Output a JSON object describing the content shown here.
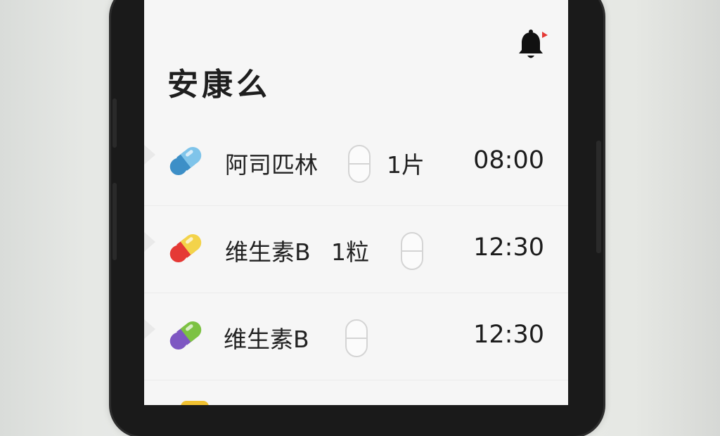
{
  "app": {
    "title": "安康么"
  },
  "header": {
    "bell_icon": "bell-icon",
    "badge_color": "#e53935"
  },
  "meds": [
    {
      "name": "阿司匹林",
      "dose": "1片",
      "time": "08:00",
      "colors": [
        "#4aa3d8",
        "#7fc4ea"
      ]
    },
    {
      "name": "维生素B",
      "dose": "1粒",
      "time": "12:30",
      "colors": [
        "#e53935",
        "#f3d34a"
      ]
    },
    {
      "name": "维生素B",
      "dose": "",
      "time": "12:30",
      "colors": [
        "#7e57c2",
        "#7cc242"
      ]
    }
  ]
}
